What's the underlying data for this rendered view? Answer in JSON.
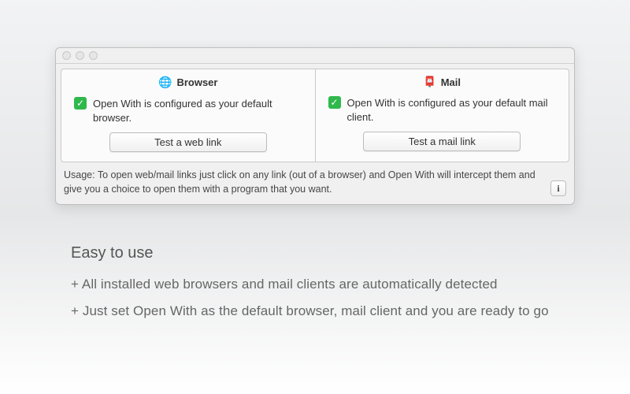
{
  "window": {
    "browser_panel": {
      "title": "Browser",
      "status": "Open With is configured as your default browser.",
      "button": "Test a web link"
    },
    "mail_panel": {
      "title": "Mail",
      "status": "Open With is configured as your default mail client.",
      "button": "Test a mail link"
    },
    "usage": "Usage: To open web/mail links just click on any link (out of a browser) and Open With will intercept them and give you a choice to open them with a program that you want.",
    "info_button": "i"
  },
  "marketing": {
    "headline": "Easy to use",
    "bullet1": "+ All installed web browsers and mail clients are automatically detected",
    "bullet2": "+ Just set Open With as the default browser, mail client and you are ready to go"
  }
}
